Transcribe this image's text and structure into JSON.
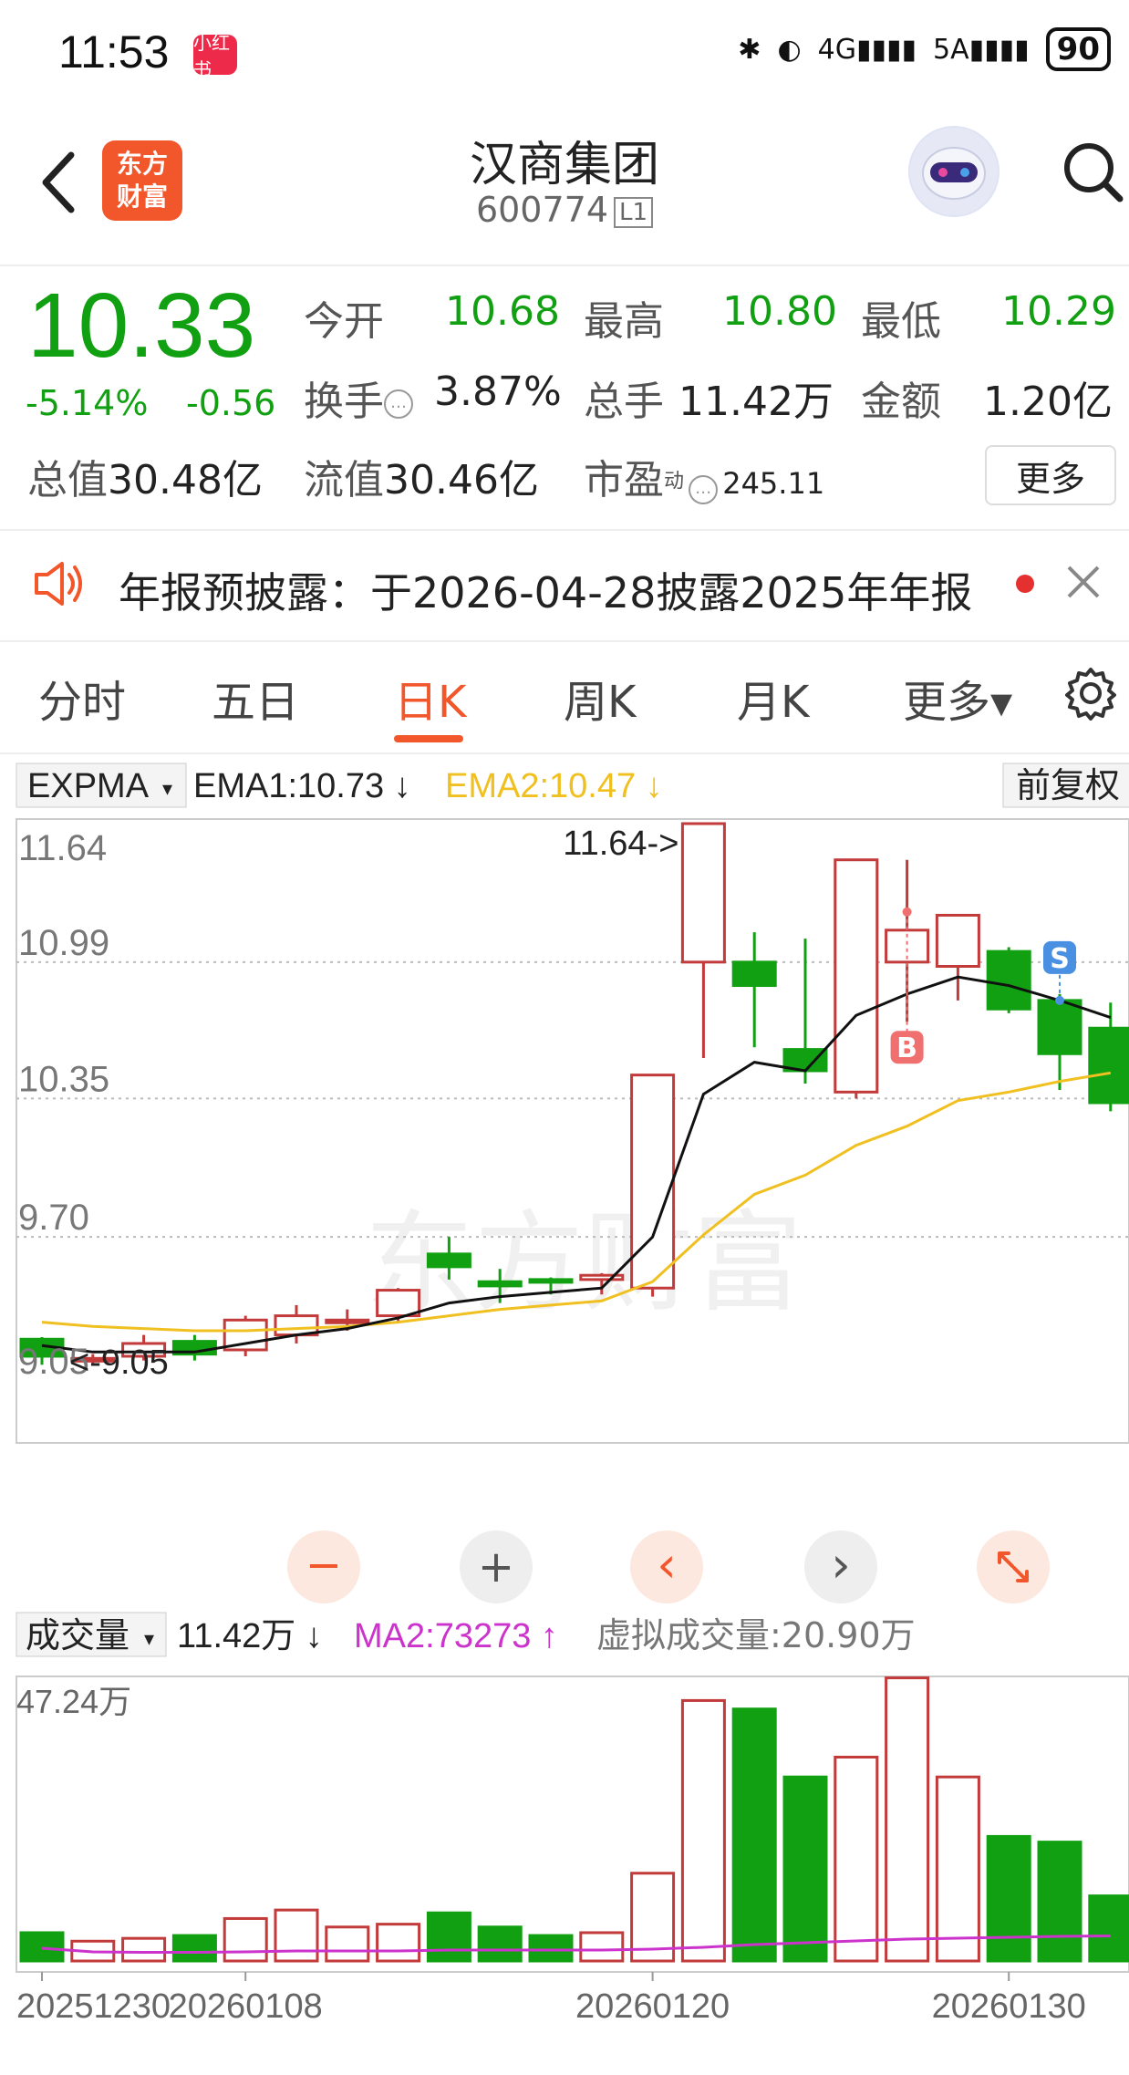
{
  "status": {
    "time": "11:53",
    "badge": "小红书",
    "network": "4G",
    "network2": "5A",
    "battery": "90"
  },
  "header": {
    "title": "汉商集团",
    "code": "600774",
    "level": "L1",
    "logo_line1": "东方",
    "logo_line2": "财富"
  },
  "quote": {
    "price": "10.33",
    "change_pct": "-5.14%",
    "change": "-0.56",
    "rows": [
      [
        {
          "label": "今开",
          "value": "10.68",
          "green": true
        },
        {
          "label": "最高",
          "value": "10.80",
          "green": true
        },
        {
          "label": "最低",
          "value": "10.29",
          "green": true
        }
      ],
      [
        {
          "label": "换手",
          "value": "3.87%",
          "green": false
        },
        {
          "label": "总手",
          "value": "11.42万",
          "green": false
        },
        {
          "label": "金额",
          "value": "1.20亿",
          "green": false
        }
      ]
    ],
    "total_value_label": "总值",
    "total_value": "30.48亿",
    "float_value_label": "流值",
    "float_value": "30.46亿",
    "pe_label": "市盈",
    "pe_sup": "动",
    "pe_value": "245.11",
    "more": "更多"
  },
  "notice": {
    "text": "年报预披露：于2026-04-28披露2025年年报"
  },
  "tabs": [
    {
      "label": "分时"
    },
    {
      "label": "五日"
    },
    {
      "label": "日K"
    },
    {
      "label": "周K"
    },
    {
      "label": "月K"
    },
    {
      "label": "更多▾"
    }
  ],
  "indicator": {
    "name": "EXPMA",
    "ema1": "EMA1:10.73",
    "ema2": "EMA2:10.47",
    "adjust": "前复权"
  },
  "volume_indicator": {
    "name": "成交量",
    "vol": "11.42万",
    "ma2": "MA2:73273",
    "virtual": "虚拟成交量:20.90万"
  },
  "watermark": "东方财富",
  "colors": {
    "up": "#c23a3a",
    "down": "#11a011",
    "ema1": "#111111",
    "ema2": "#f0c020",
    "ma2": "#cc33cc",
    "accent": "#f2562b"
  },
  "chart_data": {
    "type": "candlestick",
    "price_axis": {
      "labels": [
        "11.64",
        "10.99",
        "10.35",
        "9.70",
        "9.05"
      ],
      "ylim": [
        9.05,
        11.64
      ]
    },
    "max_marker": "11.64->",
    "min_marker": "<-9.05",
    "candles": [
      {
        "o": 9.22,
        "c": 9.14,
        "h": 9.23,
        "l": 9.1
      },
      {
        "o": 9.13,
        "c": 9.13,
        "h": 9.15,
        "l": 9.1
      },
      {
        "o": 9.14,
        "c": 9.2,
        "h": 9.24,
        "l": 9.12
      },
      {
        "o": 9.21,
        "c": 9.15,
        "h": 9.24,
        "l": 9.12
      },
      {
        "o": 9.17,
        "c": 9.31,
        "h": 9.33,
        "l": 9.14
      },
      {
        "o": 9.24,
        "c": 9.33,
        "h": 9.38,
        "l": 9.2
      },
      {
        "o": 9.31,
        "c": 9.31,
        "h": 9.36,
        "l": 9.26
      },
      {
        "o": 9.33,
        "c": 9.45,
        "h": 9.46,
        "l": 9.3
      },
      {
        "o": 9.62,
        "c": 9.56,
        "h": 9.7,
        "l": 9.5
      },
      {
        "o": 9.49,
        "c": 9.47,
        "h": 9.55,
        "l": 9.39
      },
      {
        "o": 9.5,
        "c": 9.49,
        "h": 9.51,
        "l": 9.43
      },
      {
        "o": 9.5,
        "c": 9.52,
        "h": 9.53,
        "l": 9.43
      },
      {
        "o": 9.46,
        "c": 10.46,
        "h": 10.46,
        "l": 9.42
      },
      {
        "o": 10.99,
        "c": 11.64,
        "h": 11.64,
        "l": 10.54
      },
      {
        "o": 10.99,
        "c": 10.88,
        "h": 11.13,
        "l": 10.59
      },
      {
        "o": 10.58,
        "c": 10.48,
        "h": 11.1,
        "l": 10.42
      },
      {
        "o": 10.38,
        "c": 11.47,
        "h": 11.47,
        "l": 10.35
      },
      {
        "o": 10.99,
        "c": 11.14,
        "h": 11.47,
        "l": 10.71
      },
      {
        "o": 10.97,
        "c": 11.21,
        "h": 11.21,
        "l": 10.81
      },
      {
        "o": 11.04,
        "c": 10.77,
        "h": 11.06,
        "l": 10.75
      },
      {
        "o": 10.81,
        "c": 10.56,
        "h": 10.84,
        "l": 10.39
      },
      {
        "o": 10.68,
        "c": 10.33,
        "h": 10.8,
        "l": 10.29
      }
    ],
    "ema1": [
      9.19,
      9.16,
      9.16,
      9.16,
      9.2,
      9.24,
      9.27,
      9.32,
      9.39,
      9.42,
      9.44,
      9.46,
      9.7,
      10.37,
      10.52,
      10.48,
      10.74,
      10.84,
      10.92,
      10.88,
      10.81,
      10.73
    ],
    "ema2": [
      9.3,
      9.28,
      9.27,
      9.26,
      9.26,
      9.27,
      9.28,
      9.3,
      9.33,
      9.36,
      9.38,
      9.4,
      9.49,
      9.71,
      9.9,
      9.99,
      10.13,
      10.22,
      10.34,
      10.38,
      10.43,
      10.47
    ],
    "signals": [
      {
        "index": 17,
        "label": "B"
      },
      {
        "index": 20,
        "label": "S"
      }
    ],
    "volume_axis": {
      "max_label": "47.24万",
      "max": 47.24
    },
    "volumes": [
      1.0,
      0.7,
      0.8,
      0.9,
      1.5,
      1.8,
      1.2,
      1.3,
      1.7,
      1.2,
      0.9,
      1.0,
      3.1,
      9.2,
      8.9,
      6.5,
      7.2,
      10.0,
      6.5,
      4.4,
      4.2,
      2.3
    ],
    "volume_ma2": [
      0.28,
      0.2,
      0.19,
      0.19,
      0.2,
      0.22,
      0.22,
      0.22,
      0.24,
      0.24,
      0.24,
      0.24,
      0.26,
      0.3,
      0.36,
      0.4,
      0.44,
      0.48,
      0.5,
      0.52,
      0.54,
      0.55
    ],
    "x_labels": [
      {
        "index": 0,
        "label": "20251230"
      },
      {
        "index": 4,
        "label": "20260108"
      },
      {
        "index": 12,
        "label": "20260120"
      },
      {
        "index": 19,
        "label": "20260130"
      }
    ]
  },
  "chart_controls": {
    "minus": "−",
    "plus": "+",
    "left": "‹",
    "right": "›"
  }
}
